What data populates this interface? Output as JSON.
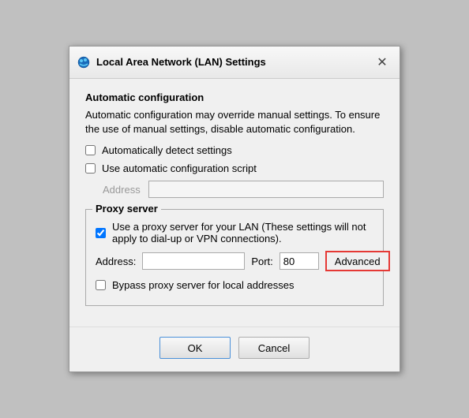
{
  "dialog": {
    "title": "Local Area Network (LAN) Settings",
    "close_label": "✕"
  },
  "automatic_config": {
    "section_label": "Automatic configuration",
    "description": "Automatic configuration may override manual settings. To ensure the use of manual settings, disable automatic configuration.",
    "detect_settings_label": "Automatically detect settings",
    "detect_settings_checked": false,
    "use_script_label": "Use automatic configuration script",
    "use_script_checked": false,
    "address_label": "Address",
    "address_placeholder": ""
  },
  "proxy_server": {
    "section_label": "Proxy server",
    "description": "Use a proxy server for your LAN (These settings will not apply to dial-up or VPN connections).",
    "use_proxy_checked": true,
    "address_label": "Address:",
    "address_value": "",
    "port_label": "Port:",
    "port_value": "80",
    "advanced_label": "Advanced",
    "bypass_label": "Bypass proxy server for local addresses",
    "bypass_checked": false
  },
  "footer": {
    "ok_label": "OK",
    "cancel_label": "Cancel"
  }
}
